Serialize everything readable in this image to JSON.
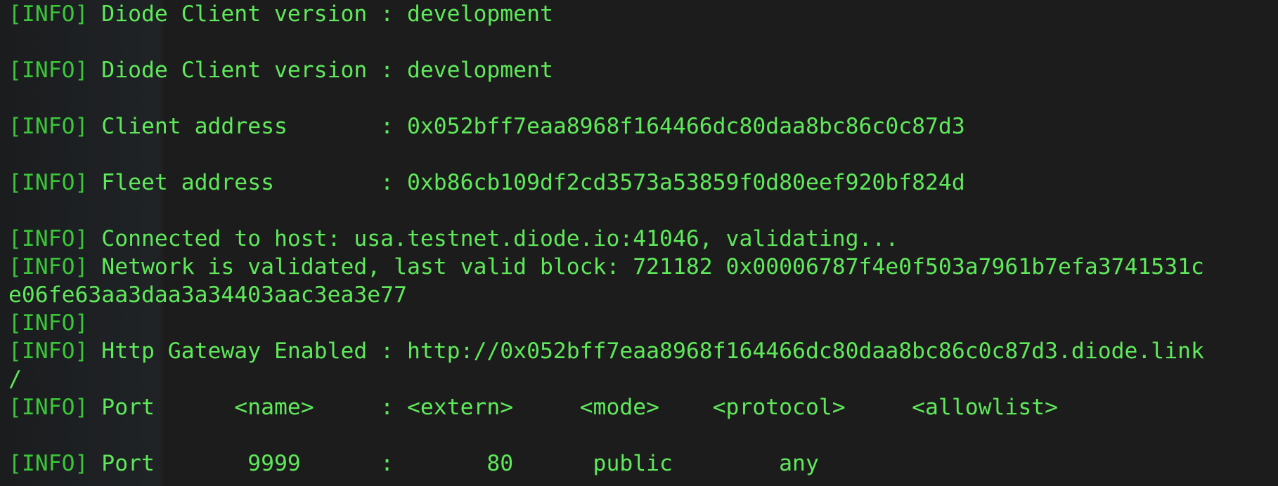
{
  "terminal": {
    "lines": [
      {
        "tag": "[INFO]",
        "text": " Diode Client version : development"
      },
      {
        "tag": "",
        "text": ""
      },
      {
        "tag": "[INFO]",
        "text": " Diode Client version : development"
      },
      {
        "tag": "",
        "text": ""
      },
      {
        "tag": "[INFO]",
        "text": " Client address       : 0x052bff7eaa8968f164466dc80daa8bc86c0c87d3"
      },
      {
        "tag": "",
        "text": ""
      },
      {
        "tag": "[INFO]",
        "text": " Fleet address        : 0xb86cb109df2cd3573a53859f0d80eef920bf824d"
      },
      {
        "tag": "",
        "text": ""
      },
      {
        "tag": "[INFO]",
        "text": " Connected to host: usa.testnet.diode.io:41046, validating..."
      },
      {
        "tag": "[INFO]",
        "text": " Network is validated, last valid block: 721182 0x00006787f4e0f503a7961b7efa3741531c"
      },
      {
        "tag": "",
        "text": "e06fe63aa3daa3a34403aac3ea3e77"
      },
      {
        "tag": "[INFO]",
        "text": ""
      },
      {
        "tag": "[INFO]",
        "text": " Http Gateway Enabled : http://0x052bff7eaa8968f164466dc80daa8bc86c0c87d3.diode.link"
      },
      {
        "tag": "",
        "text": "/"
      },
      {
        "tag": "[INFO]",
        "text": " Port      <name>     : <extern>     <mode>    <protocol>     <allowlist>"
      },
      {
        "tag": "",
        "text": ""
      },
      {
        "tag": "[INFO]",
        "text": " Port       9999      :       80      public        any"
      }
    ]
  }
}
